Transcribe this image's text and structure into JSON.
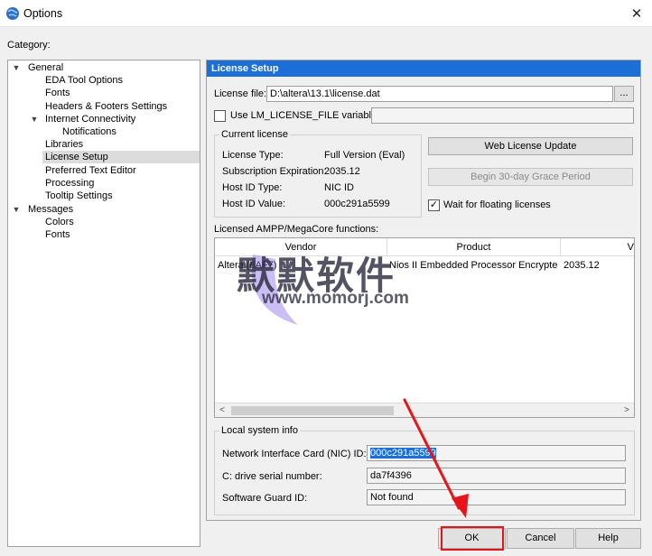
{
  "window": {
    "title": "Options",
    "close_glyph": "✕"
  },
  "category_label": "Category:",
  "tree": [
    {
      "label": "General",
      "expanded": true
    },
    {
      "label": "EDA Tool Options"
    },
    {
      "label": "Fonts"
    },
    {
      "label": "Headers & Footers Settings"
    },
    {
      "label": "Internet Connectivity",
      "expanded": true
    },
    {
      "label": "Notifications"
    },
    {
      "label": "Libraries"
    },
    {
      "label": "License Setup",
      "selected": true
    },
    {
      "label": "Preferred Text Editor"
    },
    {
      "label": "Processing"
    },
    {
      "label": "Tooltip Settings"
    },
    {
      "label": "Messages",
      "expanded": true
    },
    {
      "label": "Colors"
    },
    {
      "label": "Fonts"
    }
  ],
  "panel": {
    "header": "License Setup",
    "license_file_label": "License file:",
    "license_file_value": "D:\\altera\\13.1\\license.dat",
    "browse_label": "...",
    "use_lm_label": "Use LM_LICENSE_FILE variable:",
    "use_lm_value": "",
    "current_license": {
      "title": "Current license",
      "rows": [
        {
          "label": "License Type:",
          "value": "Full Version (Eval)"
        },
        {
          "label": "Subscription Expiration:",
          "value": "2035.12"
        },
        {
          "label": "Host ID Type:",
          "value": "NIC ID"
        },
        {
          "label": "Host ID Value:",
          "value": "000c291a5599"
        }
      ]
    },
    "web_license_button": "Web License Update",
    "grace_period_button": "Begin 30-day Grace Period",
    "wait_floating_label": "Wait for floating licenses",
    "wait_floating_checked": "✓",
    "licensed_label": "Licensed AMPP/MegaCore functions:",
    "table": {
      "columns": [
        "Vendor",
        "Product",
        "V"
      ],
      "rows": [
        {
          "vendor": "Altera (6AF7)",
          "product": "Nios II Embedded Processor Encrypte...",
          "version": "2035.12"
        }
      ]
    },
    "scroll_left": "<",
    "scroll_right": ">",
    "local_system": {
      "title": "Local system info",
      "rows": [
        {
          "label": "Network Interface Card (NIC) ID:",
          "value": "000c291a5599"
        },
        {
          "label": "C: drive serial number:",
          "value": "da7f4396"
        },
        {
          "label": "Software Guard ID:",
          "value": "Not found"
        }
      ]
    }
  },
  "footer": {
    "ok": "OK",
    "cancel": "Cancel",
    "help": "Help"
  },
  "watermark": {
    "main": "默默软件",
    "sub": "www.momorj.com"
  },
  "colors": {
    "header_blue": "#1c6fd6",
    "highlight_red": "#e5151b"
  }
}
